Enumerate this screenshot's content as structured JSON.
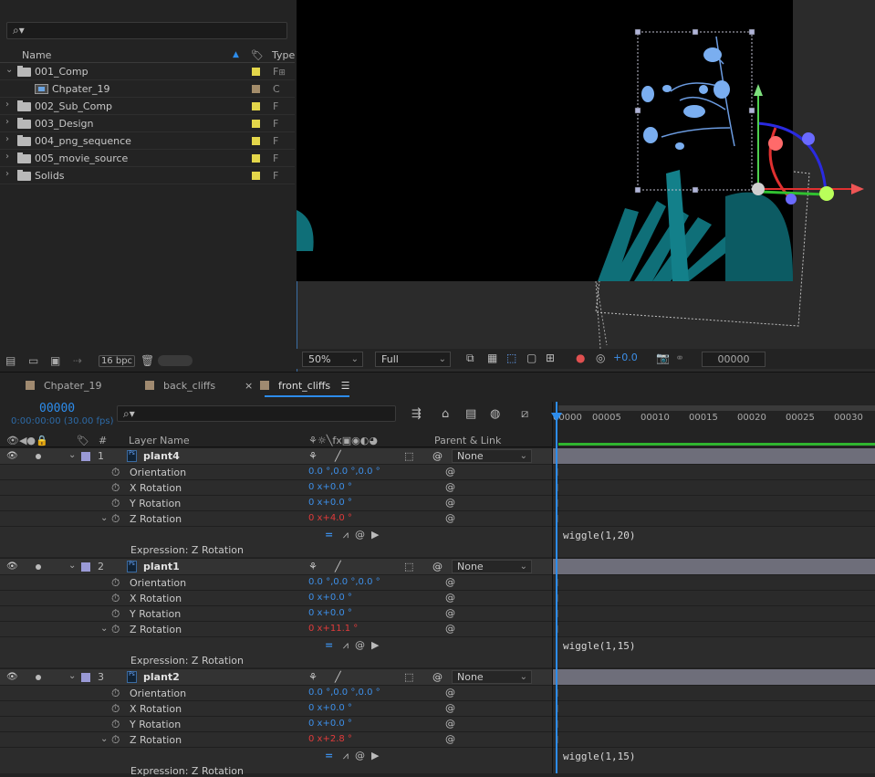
{
  "project": {
    "search_placeholder": "",
    "columns": {
      "name": "Name",
      "type": "Type"
    },
    "items": [
      {
        "name": "001_Comp",
        "kind": "folder",
        "expanded": true,
        "label_color": "#e3d64a",
        "type": "F"
      },
      {
        "name": "Chpater_19",
        "kind": "comp",
        "label_color": "#a38c6a",
        "type": "C"
      },
      {
        "name": "002_Sub_Comp",
        "kind": "folder",
        "label_color": "#e3d64a",
        "type": "F"
      },
      {
        "name": "003_Design",
        "kind": "folder",
        "label_color": "#e3d64a",
        "type": "F"
      },
      {
        "name": "004_png_sequence",
        "kind": "folder",
        "label_color": "#e3d64a",
        "type": "F"
      },
      {
        "name": "005_movie_source",
        "kind": "folder",
        "label_color": "#e3d64a",
        "type": "F"
      },
      {
        "name": "Solids",
        "kind": "folder",
        "label_color": "#e3d64a",
        "type": "F"
      }
    ],
    "bpc": "16 bpc"
  },
  "viewer": {
    "zoom": "50%",
    "resolution": "Full",
    "exposure": "+0.0",
    "timecode": "00000"
  },
  "tabs": [
    {
      "label": "Chpater_19",
      "color": "#a38c6a"
    },
    {
      "label": "back_cliffs",
      "color": "#a38c6a"
    },
    {
      "label": "front_cliffs",
      "color": "#a38c6a",
      "active": true
    }
  ],
  "timeline": {
    "timecode": "00000",
    "time_fps": "0:00:00:00 (30.00 fps)",
    "col_num": "#",
    "col_layer_name": "Layer Name",
    "col_parent": "Parent & Link",
    "ruler": [
      "00000",
      "00005",
      "00010",
      "00015",
      "00020",
      "00025",
      "00030"
    ],
    "layers": [
      {
        "num": "1",
        "name": "plant4",
        "parent": "None",
        "orientation": "0.0 °,0.0 °,0.0 °",
        "x_rot": "+0.0 °",
        "y_rot": "+0.0 °",
        "z_rot": "+4.0 °",
        "expression_label": "Expression: Z Rotation",
        "expression": "wiggle(1,20)"
      },
      {
        "num": "2",
        "name": "plant1",
        "parent": "None",
        "orientation": "0.0 °,0.0 °,0.0 °",
        "x_rot": "+0.0 °",
        "y_rot": "+0.0 °",
        "z_rot": "+11.1 °",
        "expression_label": "Expression: Z Rotation",
        "expression": "wiggle(1,15)"
      },
      {
        "num": "3",
        "name": "plant2",
        "parent": "None",
        "orientation": "0.0 °,0.0 °,0.0 °",
        "x_rot": "+0.0 °",
        "y_rot": "+0.0 °",
        "z_rot": "+2.8 °",
        "expression_label": "Expression: Z Rotation",
        "expression": "wiggle(1,15)"
      }
    ],
    "props": {
      "orientation": "Orientation",
      "x": "X Rotation",
      "y": "Y Rotation",
      "z": "Z Rotation",
      "x_prefix": "0 x"
    }
  },
  "colors": {
    "accent": "#2d8ceb",
    "folder_label": "#e3d64a",
    "layer_label": "#9a9ad6"
  }
}
